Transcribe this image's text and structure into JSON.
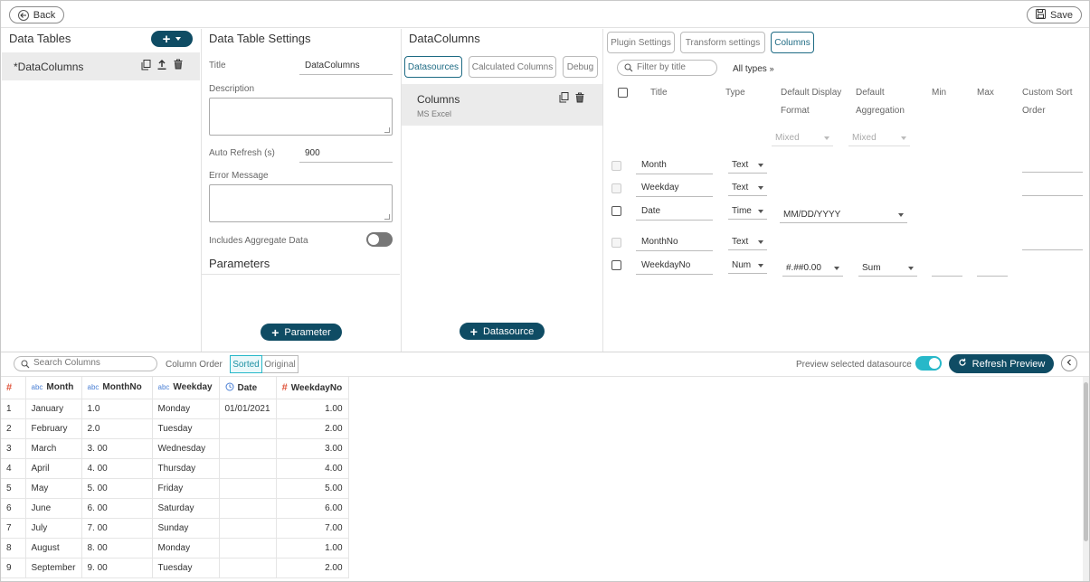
{
  "topbar": {
    "back_label": "Back",
    "save_label": "Save"
  },
  "data_tables": {
    "title": "Data Tables",
    "items": [
      {
        "label": "*DataColumns"
      }
    ]
  },
  "settings": {
    "title": "Data Table Settings",
    "title_label": "Title",
    "title_value": "DataColumns",
    "description_label": "Description",
    "auto_refresh_label": "Auto Refresh (s)",
    "auto_refresh_value": "900",
    "error_message_label": "Error Message",
    "includes_aggregate_label": "Includes Aggregate Data",
    "parameters_title": "Parameters",
    "add_parameter_label": "Parameter"
  },
  "datacolumns": {
    "title": "DataColumns",
    "tabs": [
      "Datasources",
      "Calculated Columns",
      "Debug"
    ],
    "source_name": "Columns",
    "source_type": "MS Excel",
    "add_datasource_label": "Datasource"
  },
  "columns_panel": {
    "tabs": [
      "Plugin Settings",
      "Transform settings",
      "Columns"
    ],
    "filter_placeholder": "Filter by title",
    "all_types_label": "All types",
    "headers": {
      "title": "Title",
      "type": "Type",
      "format_line1": "Default Display",
      "format_line2": "Format",
      "agg_line1": "Default",
      "agg_line2": "Aggregation",
      "min": "Min",
      "max": "Max",
      "sort_line1": "Custom Sort",
      "sort_line2": "Order"
    },
    "bulk": {
      "format": "Mixed",
      "aggregation": "Mixed"
    },
    "rows": [
      {
        "title": "Month",
        "type": "Text"
      },
      {
        "title": "Weekday",
        "type": "Text"
      },
      {
        "title": "Date",
        "type": "Time",
        "format": "MM/DD/YYYY"
      },
      {
        "title": "MonthNo",
        "type": "Text"
      },
      {
        "title": "WeekdayNo",
        "type": "Num",
        "format": "#.##0.00",
        "aggregation": "Sum"
      }
    ]
  },
  "preview": {
    "search_placeholder": "Search Columns",
    "column_order_label": "Column Order",
    "order_sorted": "Sorted",
    "order_original": "Original",
    "preview_selected_label": "Preview selected datasource",
    "refresh_label": "Refresh Preview",
    "columns": [
      {
        "type": "#",
        "name": ""
      },
      {
        "type": "abc",
        "name": "Month"
      },
      {
        "type": "abc",
        "name": "MonthNo"
      },
      {
        "type": "abc",
        "name": "Weekday"
      },
      {
        "type": "clock",
        "name": "Date"
      },
      {
        "type": "#",
        "name": "WeekdayNo"
      }
    ],
    "rows": [
      [
        "1",
        "January",
        "1.0",
        "Monday",
        "01/01/2021",
        "1.00"
      ],
      [
        "2",
        "February",
        "2.0",
        "Tuesday",
        "",
        "2.00"
      ],
      [
        "3",
        "March",
        "3. 00",
        "Wednesday",
        "",
        "3.00"
      ],
      [
        "4",
        "April",
        "4. 00",
        "Thursday",
        "",
        "4.00"
      ],
      [
        "5",
        "May",
        "5. 00",
        "Friday",
        "",
        "5.00"
      ],
      [
        "6",
        "June",
        "6. 00",
        "Saturday",
        "",
        "6.00"
      ],
      [
        "7",
        "July",
        "7. 00",
        "Sunday",
        "",
        "7.00"
      ],
      [
        "8",
        "August",
        "8. 00",
        "Monday",
        "",
        "1.00"
      ],
      [
        "9",
        "September",
        "9. 00",
        "Tuesday",
        "",
        "2.00"
      ]
    ]
  },
  "colors": {
    "accent": "#0f4c64",
    "toggle_on": "#27b8c9",
    "hash": "#e0533a",
    "type_blue": "#4a7fd4"
  }
}
